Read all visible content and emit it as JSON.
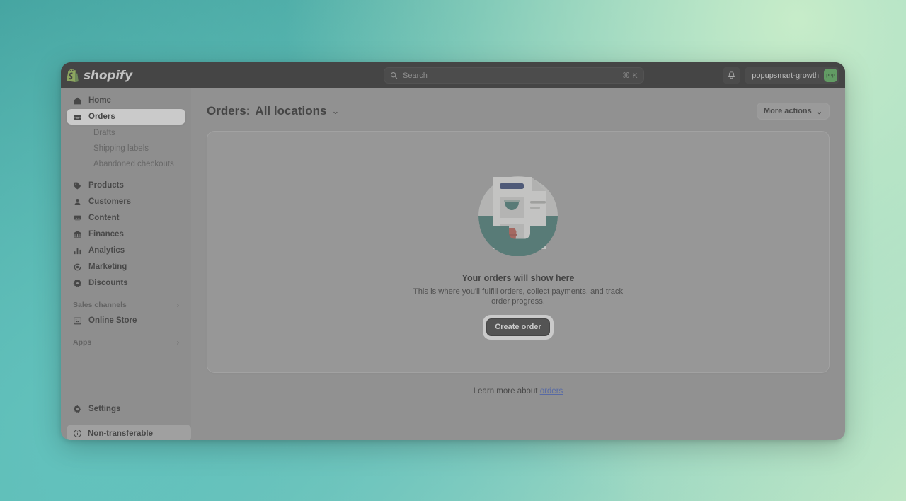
{
  "background": {
    "gradient_from": "#3f9e9b",
    "gradient_to": "#c7ecc9"
  },
  "topbar": {
    "brand": "shopify",
    "brand_icon": "shopify-bag-icon",
    "search": {
      "placeholder": "Search",
      "shortcut": "⌘ K",
      "icon": "search-icon"
    },
    "notifications_icon": "bell-icon",
    "account": {
      "name": "popupsmart-growth",
      "avatar_text": "pop",
      "avatar_color": "#4caf50"
    }
  },
  "sidebar": {
    "items": [
      {
        "label": "Home",
        "icon": "home-icon",
        "type": "item",
        "active": false
      },
      {
        "label": "Orders",
        "icon": "orders-inbox-icon",
        "type": "item",
        "active": true
      },
      {
        "label": "Drafts",
        "icon": "",
        "type": "sub",
        "active": false
      },
      {
        "label": "Shipping labels",
        "icon": "",
        "type": "sub",
        "active": false
      },
      {
        "label": "Abandoned checkouts",
        "icon": "",
        "type": "sub",
        "active": false
      },
      {
        "label": "Products",
        "icon": "tag-icon",
        "type": "item",
        "active": false
      },
      {
        "label": "Customers",
        "icon": "person-icon",
        "type": "item",
        "active": false
      },
      {
        "label": "Content",
        "icon": "content-image-icon",
        "type": "item",
        "active": false
      },
      {
        "label": "Finances",
        "icon": "bank-icon",
        "type": "item",
        "active": false
      },
      {
        "label": "Analytics",
        "icon": "bar-chart-icon",
        "type": "item",
        "active": false
      },
      {
        "label": "Marketing",
        "icon": "marketing-target-icon",
        "type": "item",
        "active": false
      },
      {
        "label": "Discounts",
        "icon": "discount-icon",
        "type": "item",
        "active": false
      }
    ],
    "sections": [
      {
        "label": "Sales channels",
        "chevron": "›"
      },
      {
        "label": "Apps",
        "chevron": "›"
      }
    ],
    "online_store": {
      "label": "Online Store",
      "icon": "storefront-icon"
    },
    "settings": {
      "label": "Settings",
      "icon": "gear-icon"
    },
    "notice": {
      "label": "Non-transferable",
      "icon": "info-circle-icon"
    }
  },
  "main": {
    "title_prefix": "Orders:",
    "title_location": "All locations",
    "title_chevron": "⌄",
    "more_actions": {
      "label": "More actions",
      "chevron": "⌄"
    },
    "empty_state": {
      "illustration": "order-document-illustration",
      "title": "Your orders will show here",
      "description": "This is where you'll fulfill orders, collect payments, and track order progress.",
      "cta_label": "Create order"
    },
    "learn_more": {
      "prefix": "Learn more about ",
      "link_text": "orders"
    }
  }
}
